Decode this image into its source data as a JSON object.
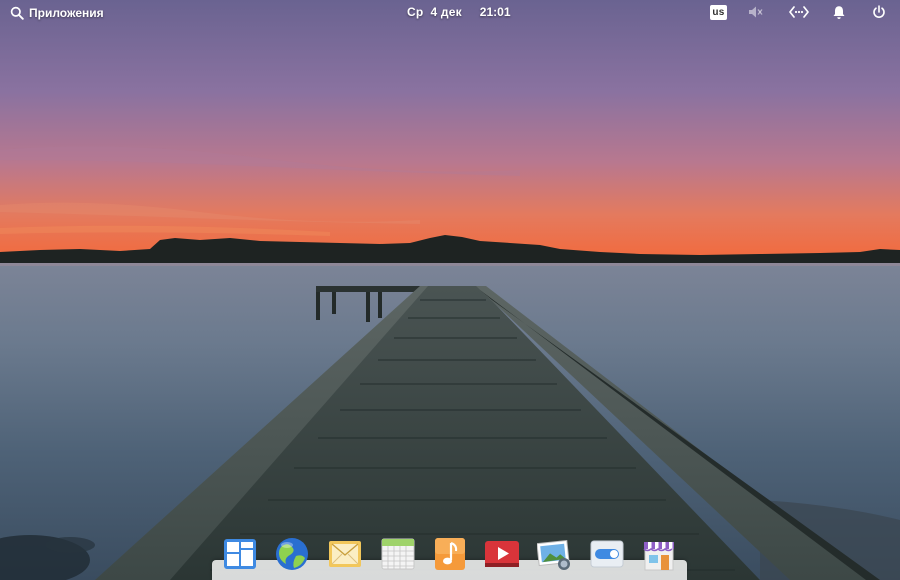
{
  "panel": {
    "apps_label": "Приложения",
    "day": "Ср",
    "date": "4 дек",
    "time": "21:01",
    "keyboard_layout": "us"
  },
  "icons": {
    "apps": "search-icon",
    "volume": "volume-muted-icon",
    "network": "network-wired-icon",
    "notifications": "bell-icon",
    "session": "power-icon"
  },
  "dock": {
    "items": [
      "multitasking-view-icon",
      "web-browser-icon",
      "mail-icon",
      "calendar-icon",
      "music-icon",
      "videos-icon",
      "photos-icon",
      "system-settings-icon",
      "appcenter-icon"
    ]
  },
  "colors": {
    "sky_top": "#6e6593",
    "sunset": "#f06e3e",
    "water": "#4e5f76",
    "pier": "#34413f"
  }
}
